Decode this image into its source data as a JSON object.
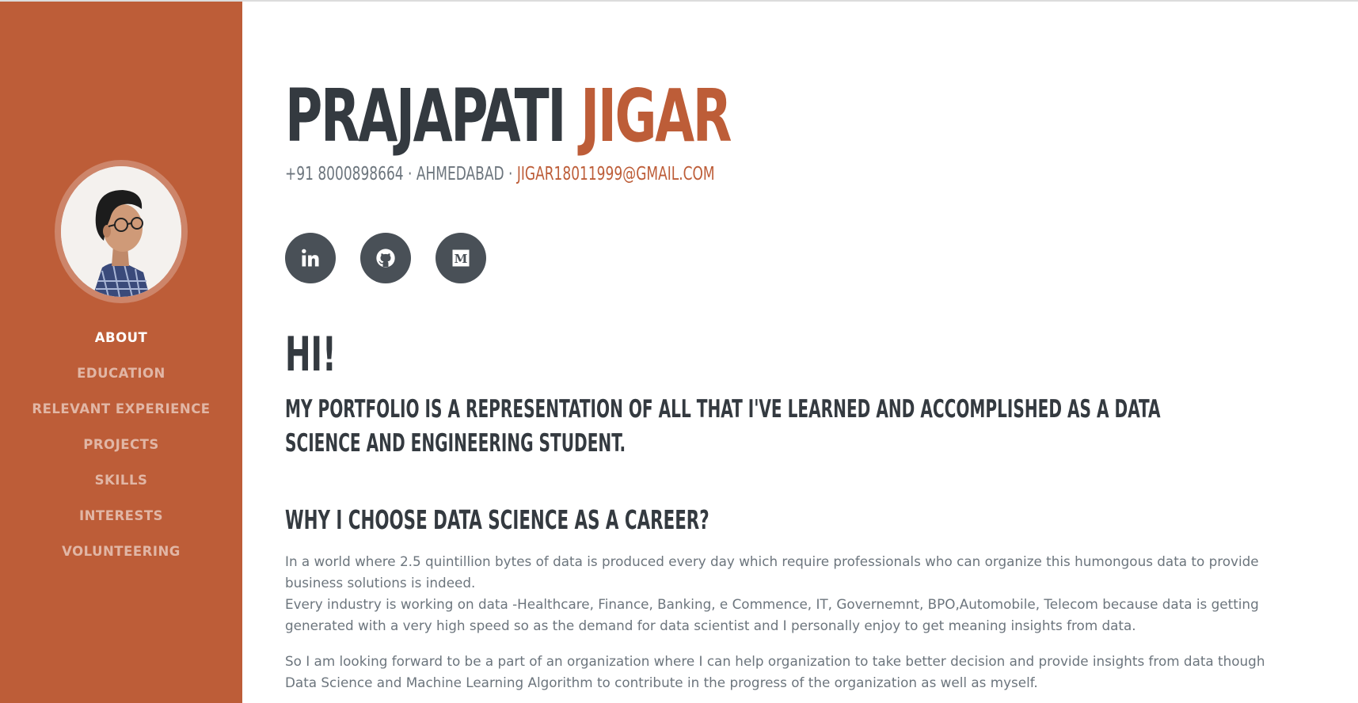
{
  "sidebar": {
    "nav": [
      {
        "label": "ABOUT",
        "active": true
      },
      {
        "label": "EDUCATION"
      },
      {
        "label": "RELEVANT EXPERIENCE"
      },
      {
        "label": "PROJECTS"
      },
      {
        "label": "SKILLS"
      },
      {
        "label": "INTERESTS"
      },
      {
        "label": "VOLUNTEERING"
      }
    ],
    "bg_color": "#bd5d38"
  },
  "header": {
    "first_name": "PRAJAPATI",
    "last_name": "JIGAR",
    "phone": "+91 8000898664",
    "city": "AHMEDABAD",
    "separator": " · ",
    "email": "JIGAR18011999@GMAIL.COM"
  },
  "socials": [
    {
      "name": "linkedin",
      "icon": "linkedin-icon"
    },
    {
      "name": "github",
      "icon": "github-icon"
    },
    {
      "name": "medium",
      "icon": "medium-icon"
    }
  ],
  "about": {
    "greeting": "HI!",
    "lead": "MY PORTFOLIO IS A REPRESENTATION OF ALL THAT I'VE LEARNED AND ACCOMPLISHED AS A DATA SCIENCE AND ENGINEERING STUDENT.",
    "subheading": "WHY I CHOOSE DATA SCIENCE AS A CAREER?",
    "para1_line1": "In a world where 2.5 quintillion bytes of data is produced every day which require professionals who can organize this humongous data to provide business solutions is indeed.",
    "para1_line2": "Every industry is working on data -Healthcare, Finance, Banking, e Commence, IT, Governemnt, BPO,Automobile, Telecom because data is getting generated with a very high speed so as the demand for data scientist and I personally enjoy to get meaning insights from data.",
    "para2": "So I am looking forward to be a part of an organization where I can help organization to take better decision and provide insights from data though Data Science and Machine Learning Algorithm to contribute in the progress of the organization as well as myself."
  },
  "colors": {
    "accent": "#bd5d38",
    "heading": "#343a40",
    "muted": "#6c757d",
    "social_bg": "#495057"
  }
}
